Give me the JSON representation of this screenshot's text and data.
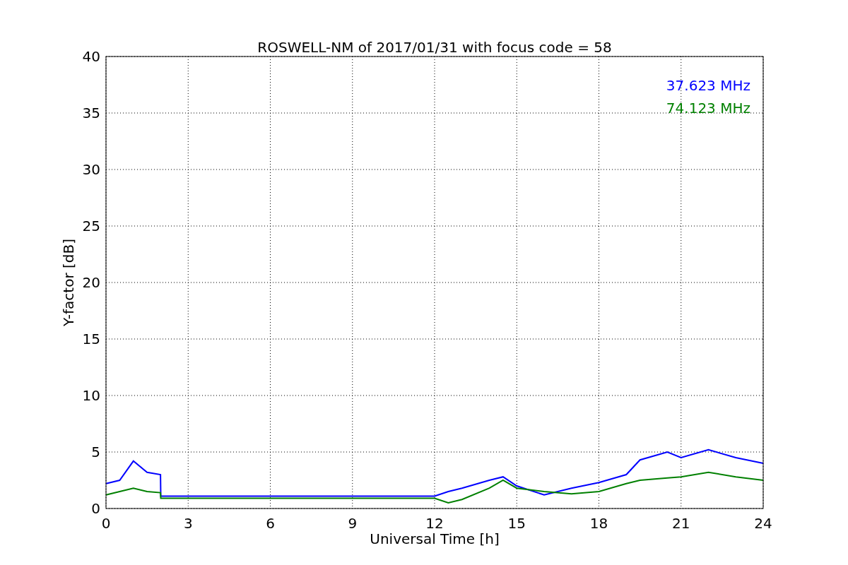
{
  "chart_data": {
    "type": "line",
    "title": "ROSWELL-NM of 2017/01/31 with focus code = 58",
    "xlabel": "Universal Time [h]",
    "ylabel": "Y-factor [dB]",
    "x": [
      0,
      0.5,
      1,
      1.5,
      1.99,
      2,
      12,
      12.5,
      13,
      14,
      14.5,
      15,
      16,
      17,
      18,
      19,
      19.5,
      20.5,
      21,
      22,
      23,
      24
    ],
    "series": [
      {
        "name": "37.623 MHz",
        "color": "#0000ff",
        "values": [
          2.2,
          2.5,
          4.2,
          3.2,
          3.0,
          1.1,
          1.1,
          1.5,
          1.8,
          2.5,
          2.8,
          2.0,
          1.2,
          1.8,
          2.3,
          3.0,
          4.3,
          5.0,
          4.5,
          5.2,
          4.5,
          4.0
        ]
      },
      {
        "name": "74.123 MHz",
        "color": "#008000",
        "values": [
          1.2,
          1.5,
          1.8,
          1.5,
          1.4,
          0.9,
          0.9,
          0.5,
          0.8,
          1.8,
          2.5,
          1.8,
          1.5,
          1.3,
          1.5,
          2.2,
          2.5,
          2.7,
          2.8,
          3.2,
          2.8,
          2.5
        ]
      }
    ],
    "xlim": [
      0,
      24
    ],
    "ylim": [
      0,
      40
    ],
    "xticks": [
      0,
      3,
      6,
      9,
      12,
      15,
      18,
      21,
      24
    ],
    "yticks": [
      0,
      5,
      10,
      15,
      20,
      25,
      30,
      35,
      40
    ],
    "grid": true
  }
}
